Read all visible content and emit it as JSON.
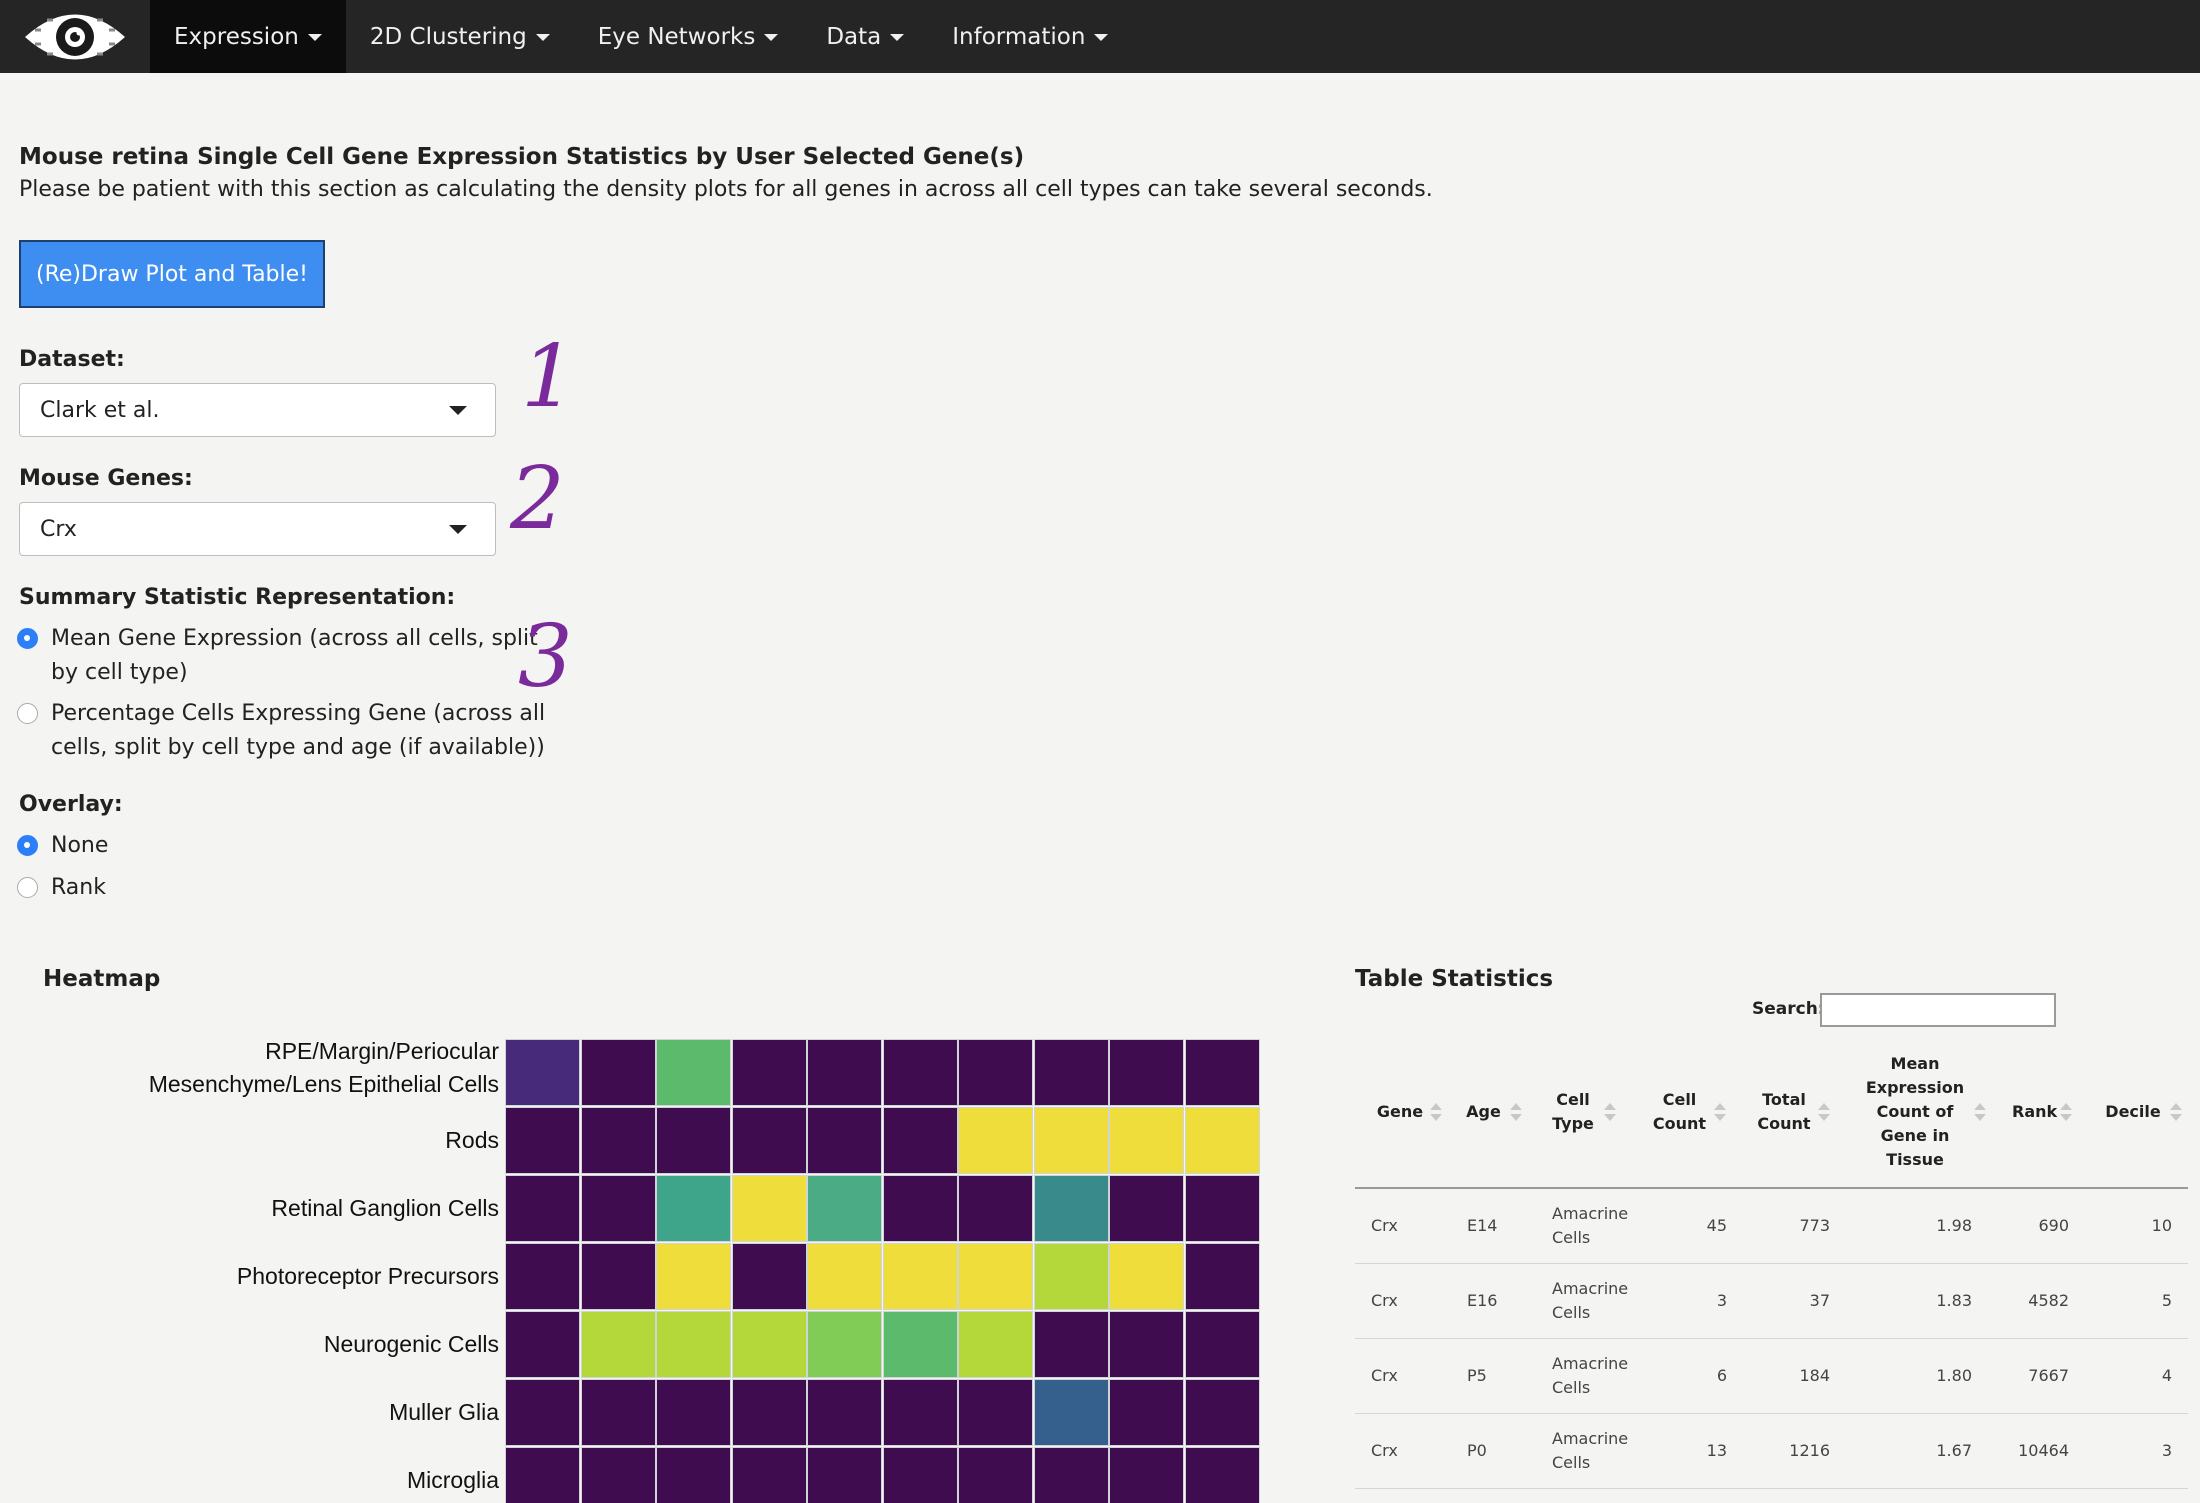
{
  "nav": {
    "items": [
      {
        "label": "Expression"
      },
      {
        "label": "2D Clustering"
      },
      {
        "label": "Eye Networks"
      },
      {
        "label": "Data"
      },
      {
        "label": "Information"
      }
    ]
  },
  "intro": {
    "title": "Mouse retina Single Cell Gene Expression Statistics by User Selected Gene(s)",
    "subtitle": "Please be patient with this section as calculating the density plots for all genes in across all cell types can take several seconds.",
    "draw_button": "(Re)Draw Plot and Table!"
  },
  "controls": {
    "dataset_label": "Dataset:",
    "dataset_value": "Clark et al.",
    "genes_label": "Mouse Genes:",
    "genes_value": "Crx",
    "summary_label": "Summary Statistic Representation:",
    "summary_options": [
      {
        "line1": "Mean Gene Expression (across all cells, split",
        "line2": "by cell type)",
        "selected": true
      },
      {
        "line1": "Percentage Cells Expressing Gene (across all",
        "line2": "cells, split by cell type and age (if available))",
        "selected": false
      }
    ],
    "overlay_label": "Overlay:",
    "overlay_options": [
      {
        "label": "None",
        "selected": true
      },
      {
        "label": "Rank",
        "selected": false
      }
    ]
  },
  "annotations": [
    "1",
    "2",
    "3"
  ],
  "heatmap": {
    "title": "Heatmap",
    "rows": [
      {
        "label1": "RPE/Margin/Periocular",
        "label2": "Mesenchyme/Lens Epithelial Cells",
        "colors": [
          "#472a7a",
          "#3f0c4f",
          "#5cba6c",
          "#3f0c4f",
          "#3f0c4f",
          "#3f0c4f",
          "#3f0c4f",
          "#3f0c4f",
          "#3f0c4f",
          "#3f0c4f"
        ]
      },
      {
        "label1": "Rods",
        "label2": "",
        "colors": [
          "#3f0c4f",
          "#3f0c4f",
          "#3f0c4f",
          "#3f0c4f",
          "#3f0c4f",
          "#3f0c4f",
          "#efdd3c",
          "#efdd3c",
          "#efdd3c",
          "#efdd3c"
        ]
      },
      {
        "label1": "Retinal Ganglion Cells",
        "label2": "",
        "colors": [
          "#3f0c4f",
          "#3f0c4f",
          "#3ea58a",
          "#efdd3c",
          "#4aab84",
          "#3f0c4f",
          "#3f0c4f",
          "#398a8a",
          "#3f0c4f",
          "#3f0c4f"
        ]
      },
      {
        "label1": "Photoreceptor Precursors",
        "label2": "",
        "colors": [
          "#3f0c4f",
          "#3f0c4f",
          "#efdd3c",
          "#3f0c4f",
          "#efdd3c",
          "#efdd3c",
          "#efdd3c",
          "#b4d83a",
          "#efdd3c",
          "#3f0c4f"
        ]
      },
      {
        "label1": "Neurogenic Cells",
        "label2": "",
        "colors": [
          "#3f0c4f",
          "#b4d83a",
          "#b4d83a",
          "#b4d83a",
          "#80cc56",
          "#5cba6c",
          "#b4d83a",
          "#3f0c4f",
          "#3f0c4f",
          "#3f0c4f"
        ]
      },
      {
        "label1": "Muller Glia",
        "label2": "",
        "colors": [
          "#3f0c4f",
          "#3f0c4f",
          "#3f0c4f",
          "#3f0c4f",
          "#3f0c4f",
          "#3f0c4f",
          "#3f0c4f",
          "#355f8c",
          "#3f0c4f",
          "#3f0c4f"
        ]
      },
      {
        "label1": "Microglia",
        "label2": "",
        "colors": [
          "#3f0c4f",
          "#3f0c4f",
          "#3f0c4f",
          "#3f0c4f",
          "#3f0c4f",
          "#3f0c4f",
          "#3f0c4f",
          "#3f0c4f",
          "#3f0c4f",
          "#3f0c4f"
        ]
      }
    ]
  },
  "table": {
    "title": "Table Statistics",
    "search_label": "Search:",
    "columns": [
      {
        "lines": [
          "Gene"
        ]
      },
      {
        "lines": [
          "Age"
        ]
      },
      {
        "lines": [
          "Cell",
          "Type"
        ]
      },
      {
        "lines": [
          "Cell",
          "Count"
        ]
      },
      {
        "lines": [
          "Total",
          "Count"
        ]
      },
      {
        "lines": [
          "Mean",
          "Expression",
          "Count of",
          "Gene in",
          "Tissue"
        ]
      },
      {
        "lines": [
          "Rank"
        ]
      },
      {
        "lines": [
          "Decile"
        ]
      }
    ],
    "rows": [
      {
        "gene": "Crx",
        "age": "E14",
        "type1": "Amacrine",
        "type2": "Cells",
        "cell_count": "45",
        "total_count": "773",
        "mean": "1.98",
        "rank": "690",
        "decile": "10"
      },
      {
        "gene": "Crx",
        "age": "E16",
        "type1": "Amacrine",
        "type2": "Cells",
        "cell_count": "3",
        "total_count": "37",
        "mean": "1.83",
        "rank": "4582",
        "decile": "5"
      },
      {
        "gene": "Crx",
        "age": "P5",
        "type1": "Amacrine",
        "type2": "Cells",
        "cell_count": "6",
        "total_count": "184",
        "mean": "1.80",
        "rank": "7667",
        "decile": "4"
      },
      {
        "gene": "Crx",
        "age": "P0",
        "type1": "Amacrine",
        "type2": "Cells",
        "cell_count": "13",
        "total_count": "1216",
        "mean": "1.67",
        "rank": "10464",
        "decile": "3"
      }
    ]
  }
}
